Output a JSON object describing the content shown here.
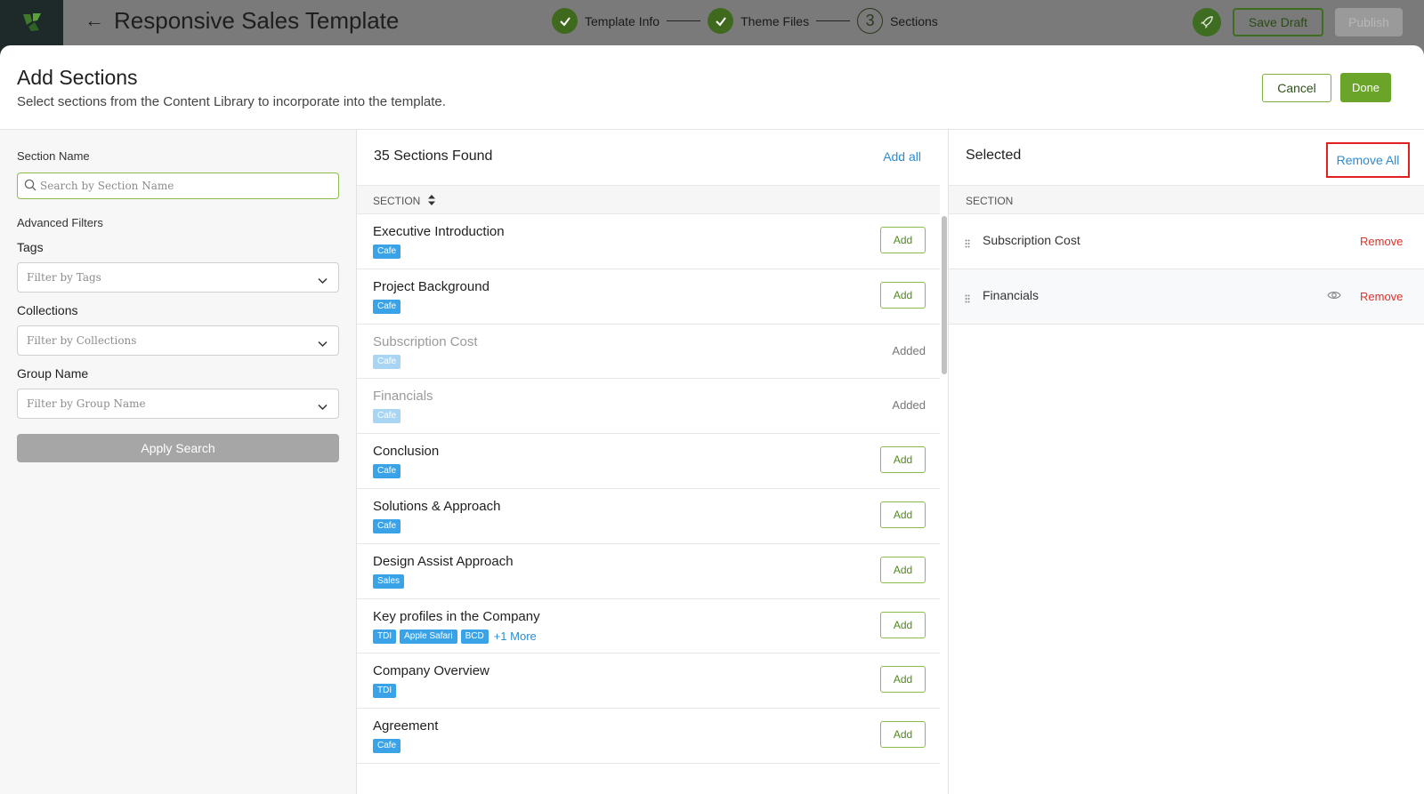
{
  "app": {
    "title": "Responsive Sales Template",
    "steps": [
      {
        "label": "Template Info",
        "state": "done"
      },
      {
        "label": "Theme Files",
        "state": "done"
      },
      {
        "label": "Sections",
        "state": "current",
        "number": "3"
      }
    ],
    "save_draft_label": "Save Draft",
    "publish_label": "Publish"
  },
  "modal": {
    "title": "Add Sections",
    "subtitle": "Select sections from the Content Library to incorporate into the template.",
    "cancel_label": "Cancel",
    "done_label": "Done"
  },
  "filters": {
    "section_name_label": "Section Name",
    "search_placeholder": "Search by Section Name",
    "advanced_label": "Advanced Filters",
    "tags_label": "Tags",
    "tags_placeholder": "Filter by Tags",
    "collections_label": "Collections",
    "collections_placeholder": "Filter by Collections",
    "group_label": "Group Name",
    "group_placeholder": "Filter by Group Name",
    "apply_label": "Apply Search"
  },
  "list": {
    "found_text": "35 Sections Found",
    "add_all_label": "Add all",
    "column_header": "SECTION",
    "add_label": "Add",
    "added_label": "Added",
    "rows": [
      {
        "title": "Executive Introduction",
        "tags": [
          "Cafe"
        ],
        "more": "",
        "added": false
      },
      {
        "title": "Project Background",
        "tags": [
          "Cafe"
        ],
        "more": "",
        "added": false
      },
      {
        "title": "Subscription Cost",
        "tags": [
          "Cafe"
        ],
        "more": "",
        "added": true
      },
      {
        "title": "Financials",
        "tags": [
          "Cafe"
        ],
        "more": "",
        "added": true
      },
      {
        "title": "Conclusion",
        "tags": [
          "Cafe"
        ],
        "more": "",
        "added": false
      },
      {
        "title": "Solutions & Approach",
        "tags": [
          "Cafe"
        ],
        "more": "",
        "added": false
      },
      {
        "title": "Design Assist Approach",
        "tags": [
          "Sales"
        ],
        "more": "",
        "added": false
      },
      {
        "title": "Key profiles in the Company",
        "tags": [
          "TDI",
          "Apple Safari",
          "BCD"
        ],
        "more": "+1 More",
        "added": false
      },
      {
        "title": "Company Overview",
        "tags": [
          "TDI"
        ],
        "more": "",
        "added": false
      },
      {
        "title": "Agreement",
        "tags": [
          "Cafe"
        ],
        "more": "",
        "added": false
      }
    ]
  },
  "selected": {
    "title": "Selected",
    "remove_all_label": "Remove All",
    "column_header": "SECTION",
    "remove_label": "Remove",
    "items": [
      {
        "name": "Subscription Cost",
        "preview_icon": false
      },
      {
        "name": "Financials",
        "preview_icon": true
      }
    ]
  },
  "colors": {
    "brand_green": "#6aa52a",
    "link_blue": "#2d8bd0",
    "tag_blue": "#3aa3e8",
    "remove_red": "#d9342b",
    "highlight_red": "#e21f1f"
  }
}
